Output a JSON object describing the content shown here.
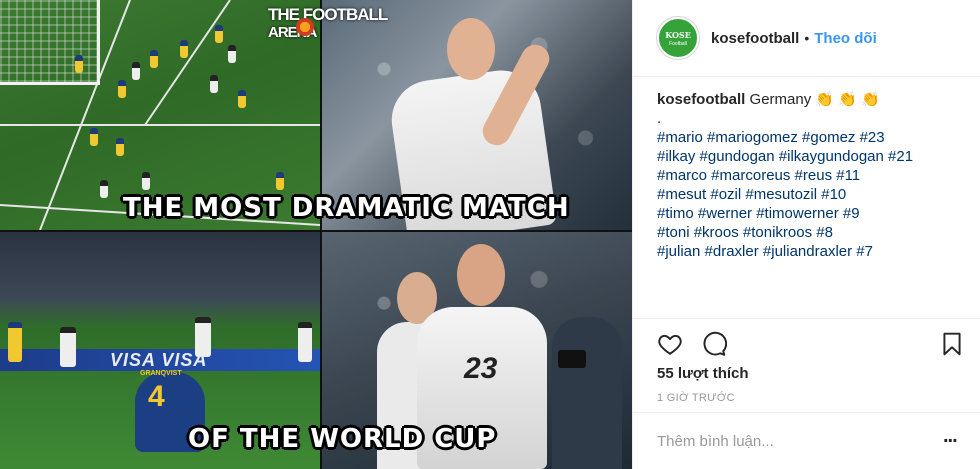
{
  "media": {
    "logo_line1": "THE FOOTBALL",
    "logo_line2": "ARENA",
    "caption_top": "THE MOST DRAMATIC MATCH",
    "caption_bottom": "OF THE WORLD CUP",
    "board_text": "VISA VISA",
    "swedish_player_number": "4",
    "swedish_player_name": "GRANQVIST",
    "german_player_number": "23"
  },
  "header": {
    "username": "kosefootball",
    "separator": "•",
    "follow_label": "Theo dõi",
    "avatar_text_main": "KOSE",
    "avatar_text_sub": "Football"
  },
  "caption": {
    "username": "kosefootball",
    "text": "Germany 👏 👏 👏",
    "dot": ".",
    "hashtag_lines": [
      "#mario #mariogomez #gomez #23",
      "#ilkay #gundogan #ilkaygundogan #21",
      "#marco #marcoreus #reus #11",
      "#mesut #ozil #mesutozil #10",
      "#timo #werner #timowerner #9",
      "#toni #kroos #tonikroos #8",
      "#julian #draxler #juliandraxler #7"
    ]
  },
  "actions": {
    "like_icon": "heart-outline-icon",
    "comment_icon": "speech-bubble-icon",
    "save_icon": "bookmark-outline-icon",
    "likes_text": "55 lượt thích",
    "timestamp": "1 GIỜ TRƯỚC"
  },
  "comment_box": {
    "placeholder": "Thêm bình luận...",
    "more_label": "..."
  }
}
